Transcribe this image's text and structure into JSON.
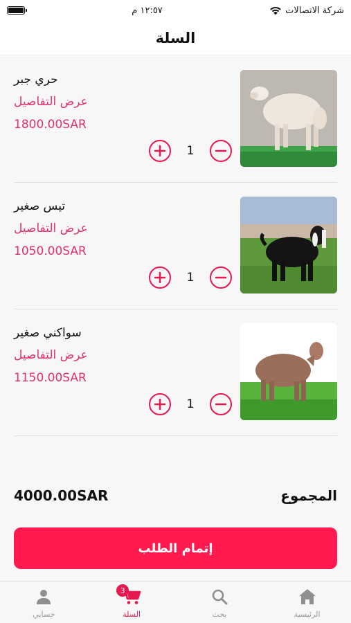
{
  "status_bar": {
    "carrier": "شركة الاتصالات",
    "time": "١٢:٥٧ م"
  },
  "header": {
    "title": "السلة"
  },
  "cart": {
    "items": [
      {
        "name": "حري جبر",
        "details_label": "عرض التفاصيل",
        "price": "1800.00SAR",
        "quantity": "1"
      },
      {
        "name": "تيس صغير",
        "details_label": "عرض التفاصيل",
        "price": "1050.00SAR",
        "quantity": "1"
      },
      {
        "name": "سواكني صغير",
        "details_label": "عرض التفاصيل",
        "price": "1150.00SAR",
        "quantity": "1"
      }
    ]
  },
  "summary": {
    "total_label": "المجموع",
    "total_value": "4000.00SAR"
  },
  "checkout": {
    "label": "إتمام الطلب"
  },
  "tab_bar": {
    "tabs": [
      {
        "label": "حسابي",
        "icon": "person-icon"
      },
      {
        "label": "السلة",
        "icon": "cart-icon",
        "badge": "3",
        "active": true
      },
      {
        "label": "بحث",
        "icon": "search-icon"
      },
      {
        "label": "الرئيسية",
        "icon": "home-icon"
      }
    ]
  },
  "colors": {
    "accent": "#e8174f",
    "button": "#ff1b4f",
    "inactive_tab": "#9a9a9a"
  }
}
